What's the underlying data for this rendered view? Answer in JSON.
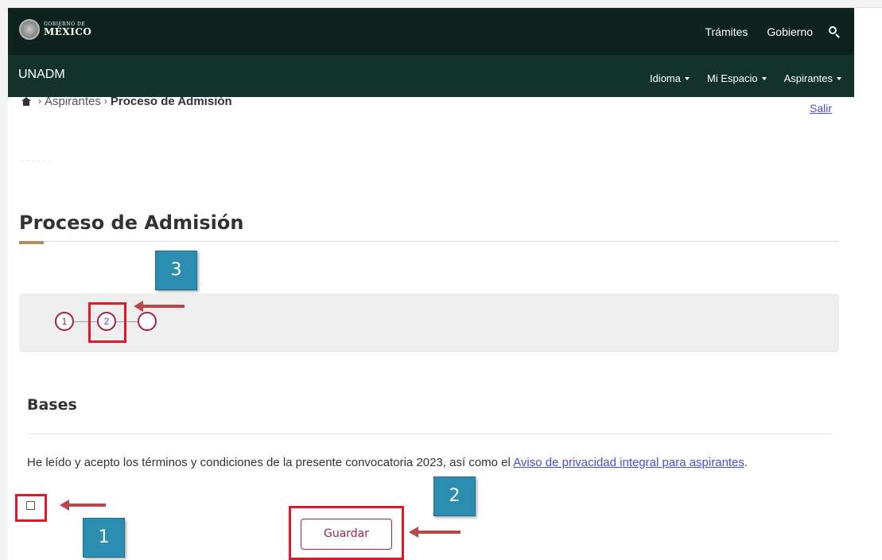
{
  "header": {
    "logo_small": "GOBIERNO DE",
    "logo_big": "MÉXICO",
    "links": [
      "Trámites",
      "Gobierno"
    ]
  },
  "subheader": {
    "brand": "UNADM",
    "menus": [
      "Idioma",
      "Mi Espacio",
      "Aspirantes"
    ]
  },
  "breadcrumb": {
    "items": [
      "Aspirantes",
      "Proceso de Admisión"
    ]
  },
  "salir_label": "Salir",
  "dashes": "------",
  "page": {
    "title": "Proceso de Admisión"
  },
  "stepper": {
    "steps": [
      "1",
      "2",
      ""
    ],
    "current_step": 2
  },
  "bases": {
    "title": "Bases",
    "terms_text": "He leído y acepto los términos y condiciones de la presente convocatoria 2023, así como el ",
    "terms_link": "Aviso de privacidad integral para aspirantes",
    "terms_end": ".",
    "checkbox_checked": false,
    "save_label": "Guardar"
  },
  "annotations": {
    "callouts": [
      "3",
      "1",
      "2"
    ],
    "highlight_color": "#e0192a",
    "callout_color": "#2b8db0",
    "arrow_color": "#b8484a"
  },
  "colors": {
    "header_bg": "#0c231e",
    "subheader_bg": "#13322b",
    "accent": "#9d2449",
    "title_accent": "#b38e5d",
    "link": "#4a4ec5"
  }
}
